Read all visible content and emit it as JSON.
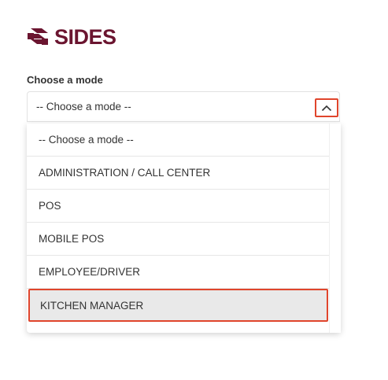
{
  "brand": {
    "name": "SIDES",
    "color": "#6b1530"
  },
  "form": {
    "label": "Choose a mode",
    "select": {
      "value": "-- Choose a mode --",
      "expanded": true,
      "chevron_icon": "chevron-up-icon"
    },
    "options": [
      {
        "label": "-- Choose a mode --",
        "selected": false
      },
      {
        "label": "ADMINISTRATION / CALL CENTER",
        "selected": false
      },
      {
        "label": "POS",
        "selected": false
      },
      {
        "label": "MOBILE POS",
        "selected": false
      },
      {
        "label": "EMPLOYEE/DRIVER",
        "selected": false
      },
      {
        "label": "KITCHEN MANAGER",
        "selected": true
      }
    ]
  },
  "colors": {
    "highlight": "#e0452c",
    "selected_bg": "#e9e9e9",
    "text": "#333333"
  }
}
